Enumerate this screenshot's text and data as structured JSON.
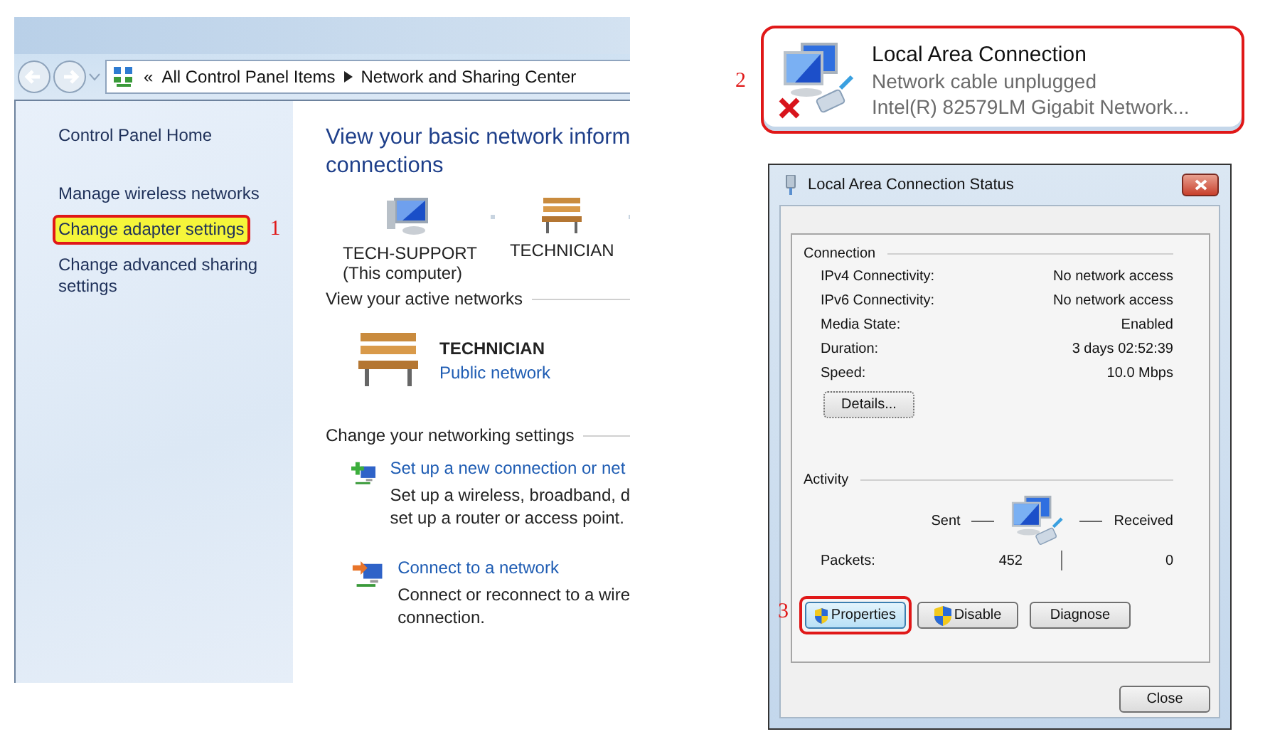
{
  "explorer": {
    "breadcrumb_chevron": "«",
    "breadcrumb": [
      "All Control Panel Items",
      "Network and Sharing Center"
    ],
    "sidebar": {
      "items": [
        {
          "label": "Control Panel Home",
          "annotated": false
        },
        {
          "label": "Manage wireless networks",
          "annotated": false
        },
        {
          "label": "Change adapter settings",
          "annotated": true,
          "callout": "1"
        },
        {
          "label": "Change advanced sharing settings",
          "annotated": false
        }
      ]
    },
    "title_lines": [
      "View your basic network inform",
      "connections"
    ],
    "map": [
      {
        "kind": "computer",
        "label": "TECH-SUPPORT",
        "sublabel": "(This computer)"
      },
      {
        "kind": "bench",
        "label": "TECHNICIAN"
      }
    ],
    "active_networks": {
      "heading": "View your active networks",
      "name": "TECHNICIAN",
      "type": "Public network"
    },
    "settings": {
      "heading": "Change your networking settings",
      "items": [
        {
          "kind": "new",
          "link": "Set up a new connection or net",
          "lines": [
            "Set up a wireless, broadband, d",
            "set up a router or access point."
          ]
        },
        {
          "kind": "connect",
          "link": "Connect to a network",
          "lines": [
            "Connect or reconnect to a wire",
            "connection."
          ]
        }
      ]
    }
  },
  "adapter": {
    "name": "Local Area Connection",
    "status": "Network cable unplugged",
    "device": "Intel(R) 82579LM Gigabit Network...",
    "disconnected": true,
    "annotated": true,
    "callout": "2"
  },
  "dialog": {
    "title": "Local Area Connection Status",
    "connection": {
      "heading": "Connection",
      "rows": [
        {
          "label": "IPv4 Connectivity:",
          "value": "No network access"
        },
        {
          "label": "IPv6 Connectivity:",
          "value": "No network access"
        },
        {
          "label": "Media State:",
          "value": "Enabled"
        },
        {
          "label": "Duration:",
          "value": "3 days 02:52:39"
        },
        {
          "label": "Speed:",
          "value": "10.0 Mbps"
        }
      ],
      "details_button": "Details..."
    },
    "activity": {
      "heading": "Activity",
      "sent": "Sent",
      "received": "Received",
      "packets_label": "Packets:",
      "packets_sent": "452",
      "packets_received": "0"
    },
    "buttons": [
      {
        "label": "Properties",
        "shield": true,
        "annotated": true,
        "callout": "3"
      },
      {
        "label": "Disable",
        "shield": true,
        "annotated": false
      },
      {
        "label": "Diagnose",
        "shield": false,
        "annotated": false
      }
    ],
    "close_button": "Close"
  }
}
